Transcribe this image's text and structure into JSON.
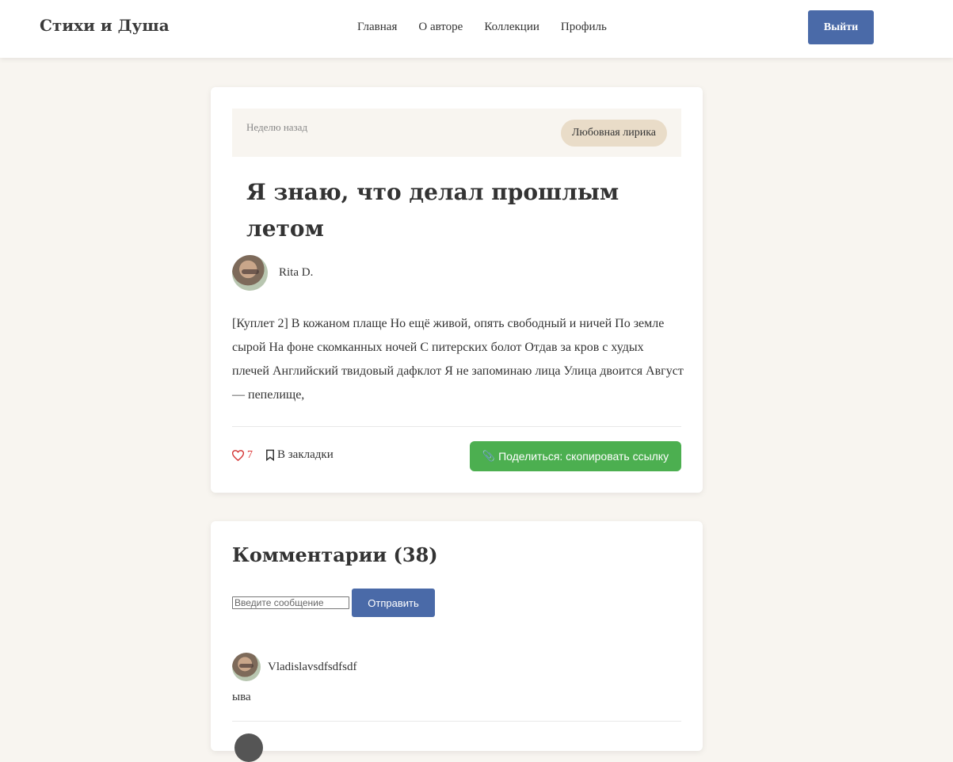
{
  "header": {
    "brand": "Стихи и Душа",
    "nav": [
      "Главная",
      "О авторе",
      "Коллекции",
      "Профиль"
    ],
    "logout_label": "Выйти"
  },
  "post": {
    "time": "Неделю назад",
    "category": "Любовная лирика",
    "title": "Я знаю, что делал прошлым летом",
    "author": "Rita D.",
    "body": "[Куплет 2] В кожаном плаще Но ещё живой, опять свободный и ничей По земле сырой На фоне скомканных ночей С питерских болот Отдав за кров с худых плечей Английский твидовый дафклот Я не запоминаю лица Улица двоится Август — пепелище,",
    "likes": "7",
    "bookmark_label": "В закладки",
    "share_label": "Поделиться: скопировать ссылку",
    "like_color": "#d33333"
  },
  "comments": {
    "title": "Комментарии (38)",
    "input_placeholder": "Введите сообщение",
    "send_label": "Отправить",
    "items": [
      {
        "author": "Vladislavsdfsdfsdf",
        "text": "ыва"
      }
    ]
  },
  "colors": {
    "primary": "#4a6aa8",
    "share": "#4caf50",
    "background": "#f8f5f0",
    "badge": "#e9dcc8"
  }
}
